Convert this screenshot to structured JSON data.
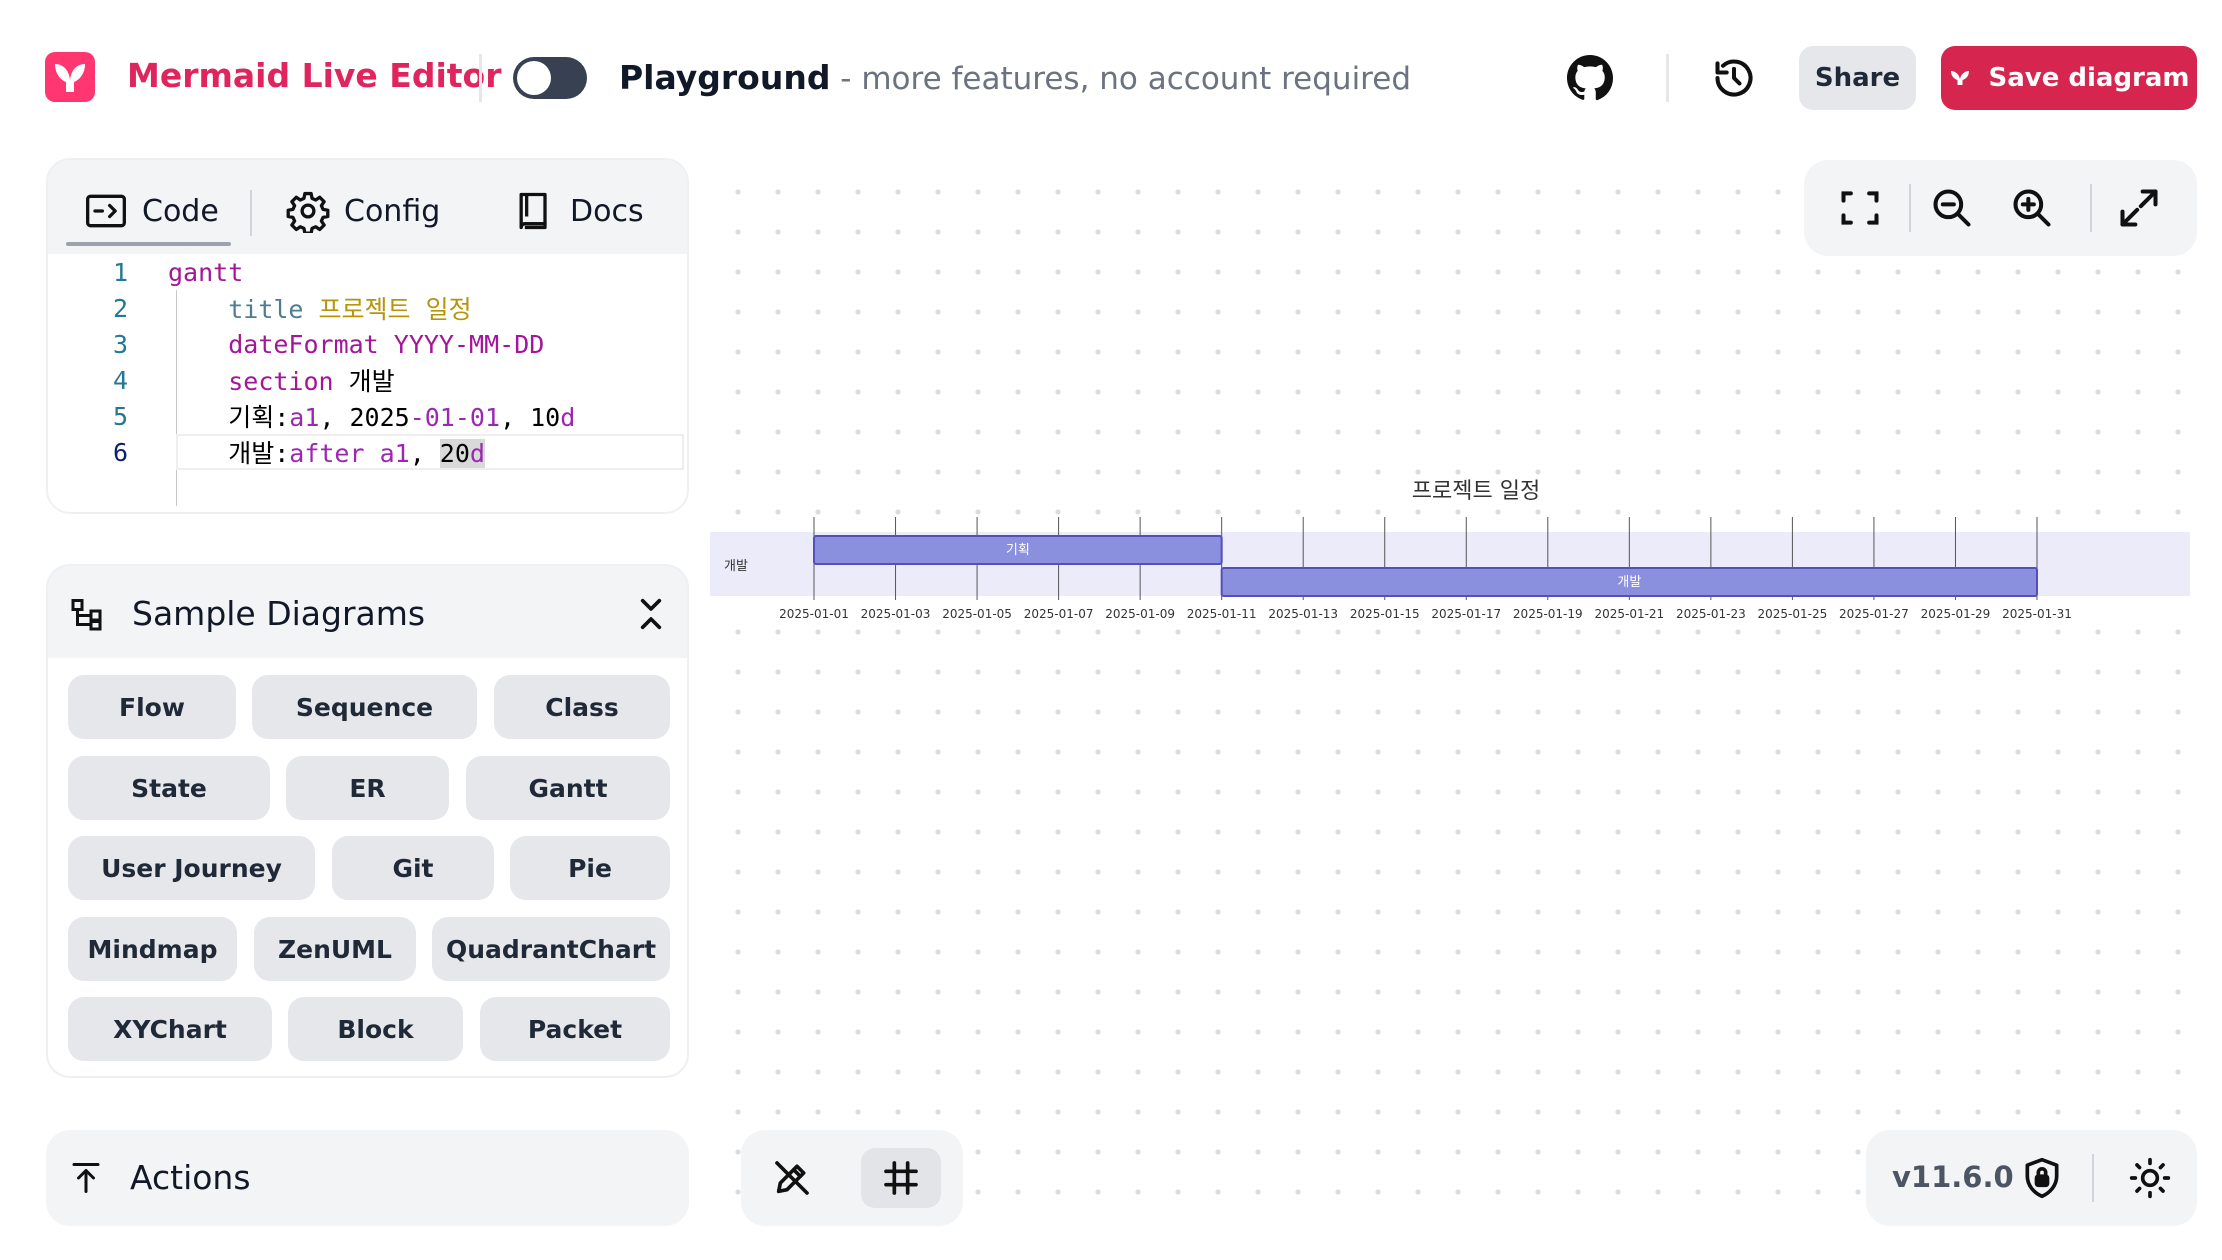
{
  "header": {
    "app_title": "Mermaid Live Editor",
    "playground_label": "Playground",
    "playground_subtitle": " - more features, no account required",
    "share_label": "Share",
    "save_label": "Save diagram",
    "brand_color": "#d6264f"
  },
  "editor": {
    "tabs": [
      {
        "label": "Code",
        "icon": "code-icon",
        "active": true
      },
      {
        "label": "Config",
        "icon": "gear-icon",
        "active": false
      },
      {
        "label": "Docs",
        "icon": "book-icon",
        "active": false
      }
    ],
    "line_numbers": [
      "1",
      "2",
      "3",
      "4",
      "5",
      "6"
    ],
    "code_lines": [
      "gantt",
      "    title 프로젝트 일정",
      "    dateFormat YYYY-MM-DD",
      "    section 개발",
      "    기획:a1, 2025-01-01, 10d",
      "    개발:after a1, 20d"
    ],
    "active_line": 6
  },
  "samples": {
    "title": "Sample Diagrams",
    "items": [
      "Flow",
      "Sequence",
      "Class",
      "State",
      "ER",
      "Gantt",
      "User Journey",
      "Git",
      "Pie",
      "Mindmap",
      "ZenUML",
      "QuadrantChart",
      "XYChart",
      "Block",
      "Packet"
    ]
  },
  "actions": {
    "title": "Actions"
  },
  "diagram": {
    "title": "프로젝트 일정",
    "section": "개발",
    "tasks": [
      {
        "name": "기획",
        "start": "2025-01-01",
        "end": "2025-01-11"
      },
      {
        "name": "개발",
        "start": "2025-01-11",
        "end": "2025-01-31"
      }
    ],
    "axis_ticks": [
      "2025-01-01",
      "2025-01-03",
      "2025-01-05",
      "2025-01-07",
      "2025-01-09",
      "2025-01-11",
      "2025-01-13",
      "2025-01-15",
      "2025-01-17",
      "2025-01-19",
      "2025-01-21",
      "2025-01-23",
      "2025-01-25",
      "2025-01-27",
      "2025-01-29",
      "2025-01-31"
    ],
    "bar_color": "#8a90dd",
    "bar_border": "#534fbc"
  },
  "footer": {
    "version": "v11.6.0"
  }
}
